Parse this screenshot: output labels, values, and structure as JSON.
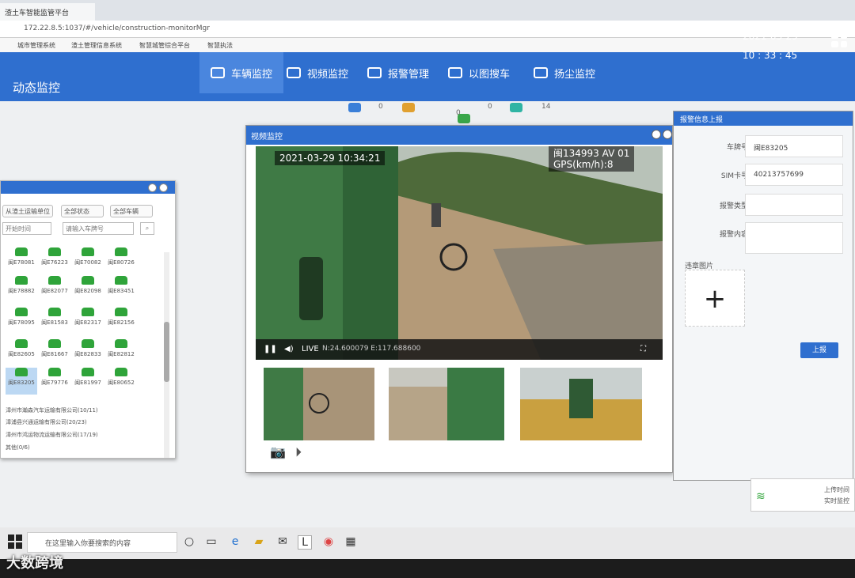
{
  "browser": {
    "tab_title": "渣土车智能监管平台",
    "address": "172.22.8.5:1037/#/vehicle/construction-monitorMgr",
    "bookmarks": [
      "城市管理系统",
      "渣土管理信息系统",
      "智慧城管综合平台",
      "智慧执法"
    ]
  },
  "header": {
    "brand": "动态监控",
    "date": "2021-03-29",
    "time": "10 : 33 : 45",
    "nav": [
      {
        "label": "车辆监控",
        "icon": "truck-icon",
        "active": true
      },
      {
        "label": "视频监控",
        "icon": "video-icon"
      },
      {
        "label": "报警管理",
        "icon": "alarm-icon"
      },
      {
        "label": "以图搜车",
        "icon": "image-search-icon"
      },
      {
        "label": "扬尘监控",
        "icon": "monitor-icon"
      }
    ]
  },
  "counts": [
    "0",
    "0",
    "0",
    "14"
  ],
  "left_panel": {
    "select_company": "从渣土运输单位",
    "select_status": "全部状态",
    "select_type": "全部车辆",
    "input_time": "开始时间",
    "input_search": "请输入车牌号",
    "vehicles": [
      "闽E78081",
      "闽E76223",
      "闽E70082",
      "闽E80726",
      "闽E78882",
      "闽E82077",
      "闽E82098",
      "闽E83451",
      "闽E78095",
      "闽E81583",
      "闽E82317",
      "闽E82156",
      "闽E82605",
      "闽E81667",
      "闽E82833",
      "闽E82812",
      "闽E83205",
      "闽E79776",
      "闽E81997",
      "闽E80652"
    ],
    "tree": [
      "漳州市瀚森汽车运输有限公司(10/11)",
      "漳浦县兴通运输有限公司(20/23)",
      "漳州市鸿运物流运输有限公司(17/19)",
      "其他(0/6)"
    ]
  },
  "video": {
    "window_title": "视频监控",
    "timestamp": "2021-03-29  10:34:21",
    "overlay_plate": "闽134993 AV 01",
    "overlay_gps": "GPS(km/h):8",
    "coords": "N:24.600079  E:117.688600",
    "live_label": "LIVE"
  },
  "alarm_form": {
    "title": "报警信息上报",
    "plate_label": "车牌号",
    "plate_value": "闽E83205",
    "sim_label": "SIM卡号",
    "sim_value": "40213757699",
    "type_label": "报警类型",
    "content_label": "报警内容",
    "evidence_label": "违章图片",
    "add_symbol": "+",
    "upload_button": "上报"
  },
  "notification": {
    "line1": "上传时间",
    "line2": "实时监控"
  },
  "taskbar": {
    "search_placeholder": "在这里输入你要搜索的内容"
  },
  "watermark": "大数跨境",
  "colors": {
    "primary": "#2f6fcf",
    "vehicle_online": "#2fa43a"
  }
}
